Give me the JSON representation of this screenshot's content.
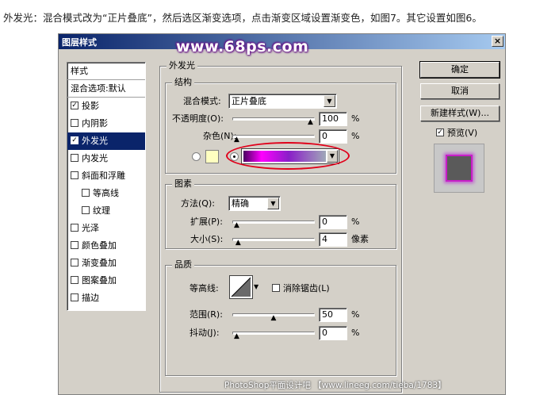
{
  "caption": "外发光：混合模式改为“正片叠底”，然后选区渐变选项，点击渐变区域设置渐变色，如图7。其它设置如图6。",
  "watermark": "www.68ps.com",
  "footer_watermark": "PhotoShop平面设计吧 【www.lineeg.com/tieba/1783】",
  "dialog": {
    "title": "图层样式",
    "close_icon": "×"
  },
  "styles_panel": {
    "header": "样式",
    "blend_options": "混合选项:默认",
    "items": [
      {
        "label": "投影",
        "checked": true,
        "indent": false,
        "selected": false
      },
      {
        "label": "内阴影",
        "checked": false,
        "indent": false,
        "selected": false
      },
      {
        "label": "外发光",
        "checked": true,
        "indent": false,
        "selected": true
      },
      {
        "label": "内发光",
        "checked": false,
        "indent": false,
        "selected": false
      },
      {
        "label": "斜面和浮雕",
        "checked": false,
        "indent": false,
        "selected": false
      },
      {
        "label": "等高线",
        "checked": false,
        "indent": true,
        "selected": false
      },
      {
        "label": "纹理",
        "checked": false,
        "indent": true,
        "selected": false
      },
      {
        "label": "光泽",
        "checked": false,
        "indent": false,
        "selected": false
      },
      {
        "label": "颜色叠加",
        "checked": false,
        "indent": false,
        "selected": false
      },
      {
        "label": "渐变叠加",
        "checked": false,
        "indent": false,
        "selected": false
      },
      {
        "label": "图案叠加",
        "checked": false,
        "indent": false,
        "selected": false
      },
      {
        "label": "描边",
        "checked": false,
        "indent": false,
        "selected": false
      }
    ]
  },
  "outer_glow": {
    "title": "外发光",
    "structure": {
      "title": "结构",
      "blend_mode_label": "混合模式:",
      "blend_mode_value": "正片叠底",
      "opacity_label": "不透明度(O):",
      "opacity_value": "100",
      "opacity_unit": "%",
      "opacity_level": 1.0,
      "noise_label": "杂色(N):",
      "noise_value": "0",
      "noise_unit": "%",
      "noise_level": 0.0,
      "color_swatch": "#ffffc0",
      "gradient_colors": [
        "#4a0060",
        "#ff00ff",
        "#8a1ec8",
        "#a0a8b8"
      ]
    },
    "elements": {
      "title": "图素",
      "method_label": "方法(Q):",
      "method_value": "精确",
      "spread_label": "扩展(P):",
      "spread_value": "0",
      "spread_unit": "%",
      "spread_level": 0.0,
      "size_label": "大小(S):",
      "size_value": "4",
      "size_unit": "像素",
      "size_level": 0.02
    },
    "quality": {
      "title": "品质",
      "contour_label": "等高线:",
      "antialias_label": "消除锯齿(L)",
      "range_label": "范围(R):",
      "range_value": "50",
      "range_unit": "%",
      "range_level": 0.5,
      "jitter_label": "抖动(J):",
      "jitter_value": "0",
      "jitter_unit": "%",
      "jitter_level": 0.0
    }
  },
  "buttons": {
    "ok": "确定",
    "cancel": "取消",
    "new_style": "新建样式(W)...",
    "preview_label": "预览(V)",
    "preview_checked": true
  },
  "icons": {
    "slider_thumb": "▲",
    "dropdown_arrow": "▼",
    "check": "✓"
  }
}
